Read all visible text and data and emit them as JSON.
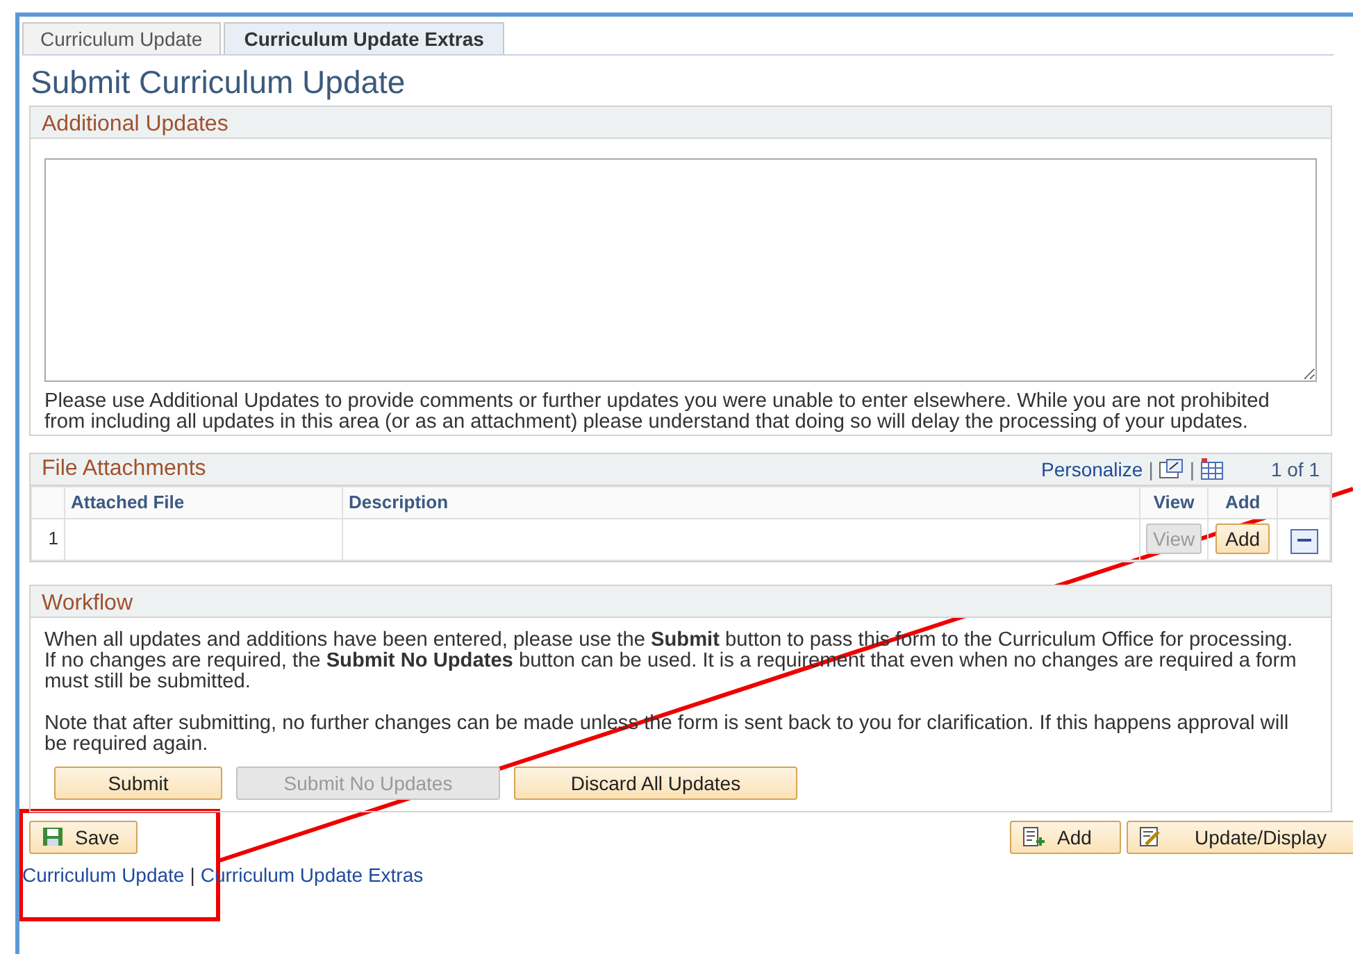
{
  "tabs": [
    {
      "label": "Curriculum Update",
      "selected": false
    },
    {
      "label": "Curriculum Update Extras",
      "selected": true
    }
  ],
  "page_title": "Submit Curriculum Update",
  "additional_updates": {
    "title": "Additional Updates",
    "note": "Please use Additional Updates to provide comments or further updates you were unable to enter elsewhere. While you are not prohibited from including all updates in this area (or as an attachment) please understand that doing so will delay the processing of your updates."
  },
  "file_attachments": {
    "title": "File Attachments",
    "personalize": "Personalize",
    "separator": "|",
    "count": "1 of 1",
    "columns": [
      "Attached File",
      "Description",
      "View",
      "Add"
    ],
    "rows": [
      {
        "number": "1",
        "attached_file": "",
        "description": "",
        "view_button": {
          "label": "View",
          "disabled": true
        },
        "add_button": {
          "label": "Add",
          "disabled": false
        }
      }
    ]
  },
  "workflow": {
    "title": "Workflow",
    "paragraphs": [
      "When all updates and additions have been entered, please use the **Submit** button to pass this form to the Curriculum Office for processing. If no changes are required, the **Submit No Updates** button can be used. It is a requirement that even when no changes are required a form must still be submitted.",
      "Note that after submitting, no further changes can be made unless the form is sent back to you for clarification. If this happens approval will be required again."
    ],
    "buttons": [
      {
        "label": "Submit",
        "disabled": false
      },
      {
        "label": "Submit No Updates",
        "disabled": true
      },
      {
        "label": "Discard All Updates",
        "disabled": false
      }
    ]
  },
  "toolbar": {
    "left": [
      {
        "label": "Save",
        "kind": "save"
      }
    ],
    "right": [
      {
        "label": "Add",
        "kind": "add"
      },
      {
        "label": "Update/Display",
        "kind": "update"
      }
    ]
  },
  "footer_links": [
    "Curriculum Update",
    "Curriculum Update Extras"
  ],
  "footer_separator": "|"
}
